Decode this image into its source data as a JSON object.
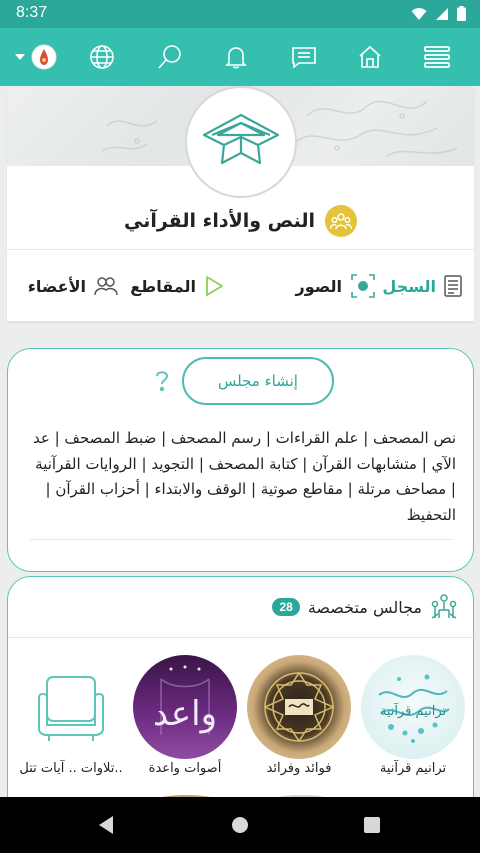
{
  "status_bar": {
    "time": "8:37"
  },
  "app_bar": {
    "icons": [
      "avatar-icon",
      "globe-icon",
      "search-icon",
      "bell-icon",
      "messages-icon",
      "home-icon",
      "menu-icon"
    ]
  },
  "group": {
    "title": "النص والأداء القرآني"
  },
  "tabs": [
    {
      "label": "السجل",
      "icon": "document-icon",
      "active": true
    },
    {
      "label": "الصور",
      "icon": "camera-icon",
      "active": false
    },
    {
      "label": "المقاطع",
      "icon": "play-icon",
      "active": false
    },
    {
      "label": "الأعضاء",
      "icon": "members-icon",
      "active": false
    }
  ],
  "create": {
    "button_label": "إنشاء مجلس",
    "topics": "نص المصحف | علم القراءات | رسم المصحف | ضبط المصحف | عد الآي | متشابهات القرآن | كتابة المصحف | التجويد | الروايات القرآنية | مصاحف مرتلة | مقاطع صوتية | الوقف والابتداء | أحزاب القرآن | التحفيظ"
  },
  "specialized": {
    "title": "مجالس متخصصة",
    "count": "28",
    "items": [
      {
        "label": "ترانيم قرآنية",
        "thumb_text": "ترانيم قرآنية"
      },
      {
        "label": "فوائد وفرائد",
        "thumb_text": ""
      },
      {
        "label": "أصوات واعدة",
        "thumb_text": "واعد"
      },
      {
        "label": "تلاوات .. آيات تتل..",
        "thumb_text": ""
      }
    ]
  },
  "colors": {
    "primary": "#35bfae",
    "primary_dark": "#2ba89a",
    "badge_gold": "#e4c338"
  }
}
